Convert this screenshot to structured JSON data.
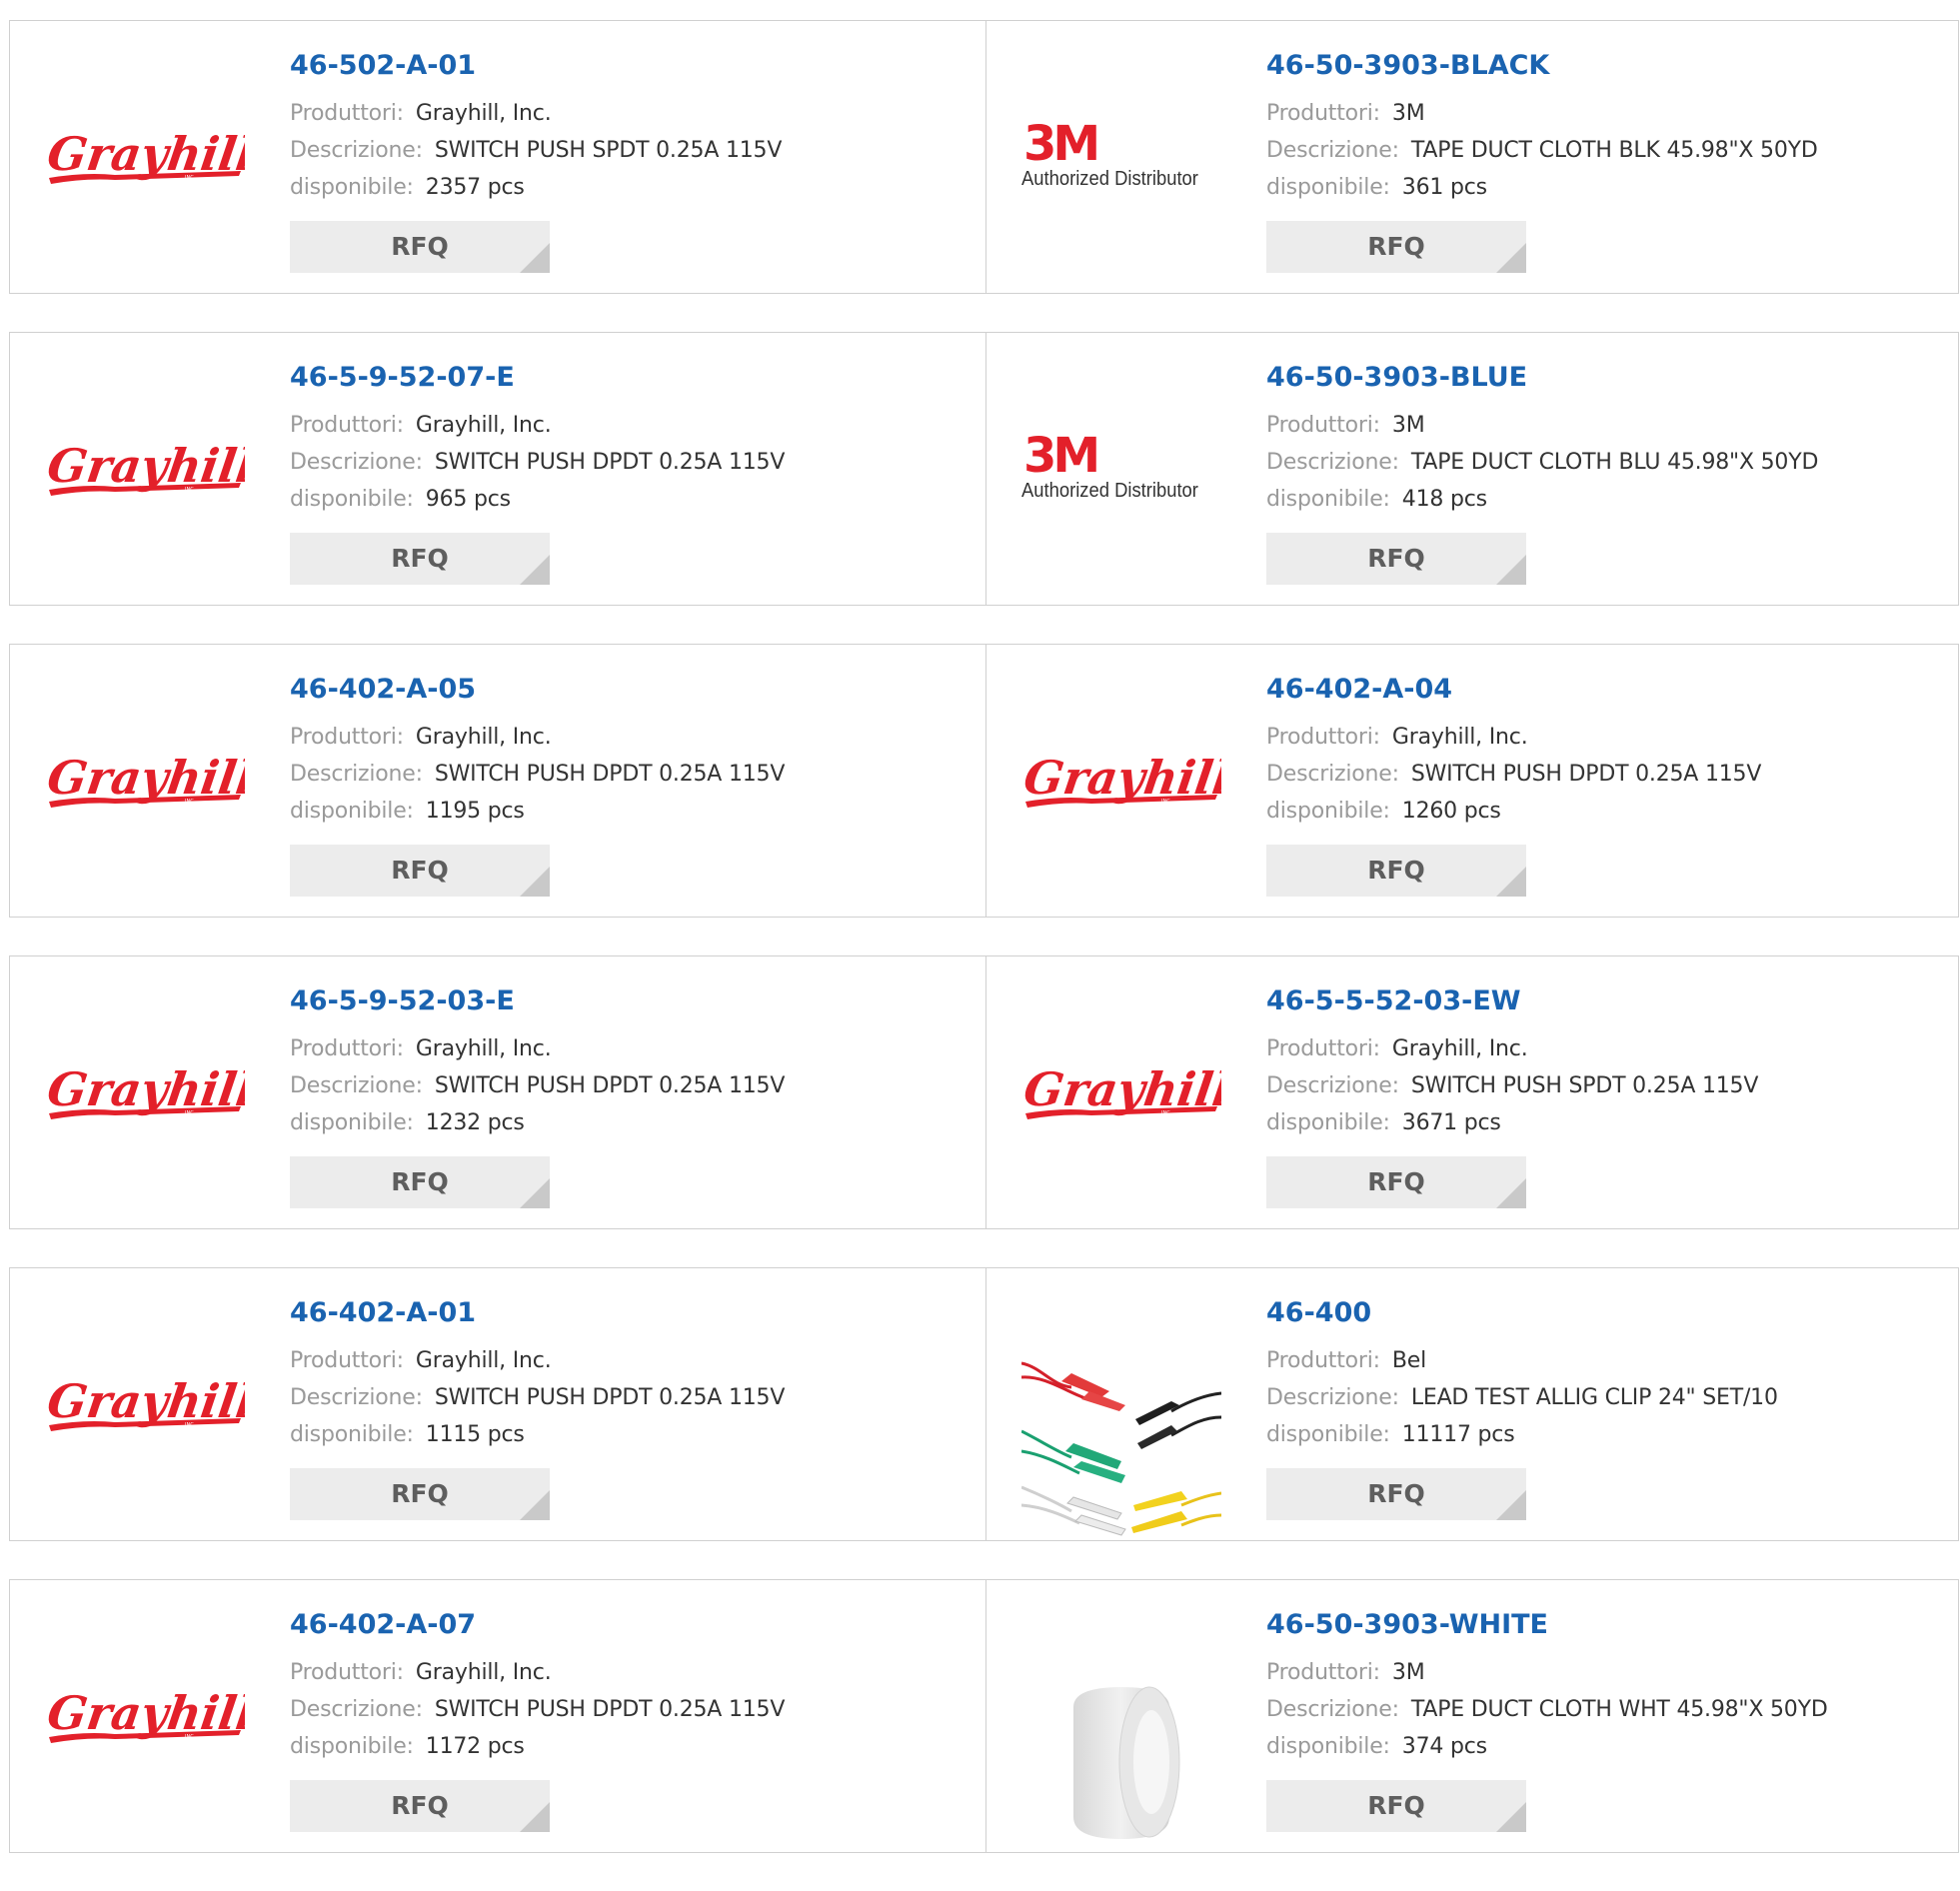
{
  "labels": {
    "manufacturer": "Produttori:",
    "description": "Descrizione:",
    "available": "disponibile:",
    "rfq": "RFQ"
  },
  "colors": {
    "part_link": "#1a63b0",
    "label_gray": "#9a9a9a",
    "value_dark": "#333333",
    "grayhill_red": "#e3202a",
    "rfq_bg": "#ececec"
  },
  "products": [
    {
      "part_number": "46-502-A-01",
      "manufacturer": "Grayhill, Inc.",
      "description": "SWITCH PUSH SPDT 0.25A 115V",
      "available": "2357 pcs",
      "logo": "grayhill-logo"
    },
    {
      "part_number": "46-50-3903-BLACK",
      "manufacturer": "3M",
      "description": "TAPE DUCT CLOTH BLK 45.98\"X 50YD",
      "available": "361 pcs",
      "logo": "3m-authorized-distributor-logo",
      "logo_text": "Authorized Distributor"
    },
    {
      "part_number": "46-5-9-52-07-E",
      "manufacturer": "Grayhill, Inc.",
      "description": "SWITCH PUSH DPDT 0.25A 115V",
      "available": "965 pcs",
      "logo": "grayhill-logo"
    },
    {
      "part_number": "46-50-3903-BLUE",
      "manufacturer": "3M",
      "description": "TAPE DUCT CLOTH BLU 45.98\"X 50YD",
      "available": "418 pcs",
      "logo": "3m-authorized-distributor-logo",
      "logo_text": "Authorized Distributor"
    },
    {
      "part_number": "46-402-A-05",
      "manufacturer": "Grayhill, Inc.",
      "description": "SWITCH PUSH DPDT 0.25A 115V",
      "available": "1195 pcs",
      "logo": "grayhill-logo"
    },
    {
      "part_number": "46-402-A-04",
      "manufacturer": "Grayhill, Inc.",
      "description": "SWITCH PUSH DPDT 0.25A 115V",
      "available": "1260 pcs",
      "logo": "grayhill-logo"
    },
    {
      "part_number": "46-5-9-52-03-E",
      "manufacturer": "Grayhill, Inc.",
      "description": "SWITCH PUSH DPDT 0.25A 115V",
      "available": "1232 pcs",
      "logo": "grayhill-logo"
    },
    {
      "part_number": "46-5-5-52-03-EW",
      "manufacturer": "Grayhill, Inc.",
      "description": "SWITCH PUSH SPDT 0.25A 115V",
      "available": "3671 pcs",
      "logo": "grayhill-logo"
    },
    {
      "part_number": "46-402-A-01",
      "manufacturer": "Grayhill, Inc.",
      "description": "SWITCH PUSH DPDT 0.25A 115V",
      "available": "1115 pcs",
      "logo": "grayhill-logo"
    },
    {
      "part_number": "46-400",
      "manufacturer": "Bel",
      "description": "LEAD TEST ALLIG CLIP 24\" SET/10",
      "available": "11117 pcs",
      "logo": "alligator-clip-leads-photo"
    },
    {
      "part_number": "46-402-A-07",
      "manufacturer": "Grayhill, Inc.",
      "description": "SWITCH PUSH DPDT 0.25A 115V",
      "available": "1172 pcs",
      "logo": "grayhill-logo"
    },
    {
      "part_number": "46-50-3903-WHITE",
      "manufacturer": "3M",
      "description": "TAPE DUCT CLOTH WHT 45.98\"X 50YD",
      "available": "374 pcs",
      "logo": "white-tape-roll-photo"
    }
  ]
}
